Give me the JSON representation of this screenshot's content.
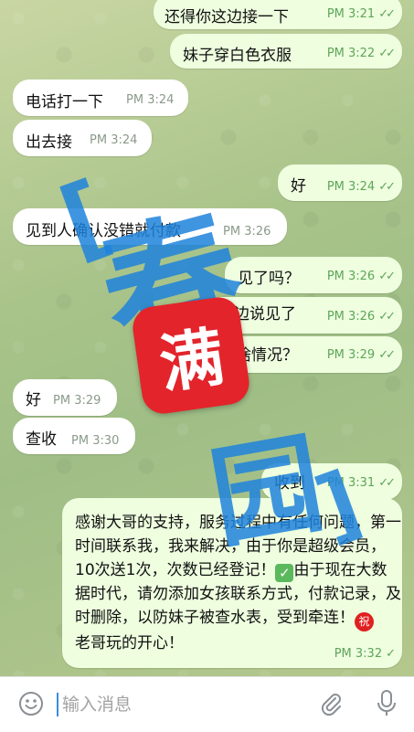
{
  "messages": [
    {
      "id": "m1",
      "dir": "out",
      "text": "还得你这边接一下",
      "time": "PM 3:21",
      "ticks": "✓✓"
    },
    {
      "id": "m2",
      "dir": "out",
      "text": "妹子穿白色衣服",
      "time": "PM 3:22",
      "ticks": "✓✓"
    },
    {
      "id": "m3",
      "dir": "in",
      "text": "电话打一下",
      "time": "PM 3:24"
    },
    {
      "id": "m4",
      "dir": "in",
      "text": "出去接",
      "time": "PM 3:24"
    },
    {
      "id": "m5",
      "dir": "out",
      "text": "好",
      "time": "PM 3:24",
      "ticks": "✓✓"
    },
    {
      "id": "m6",
      "dir": "in",
      "text": "见到人确认没错就付款",
      "time": "PM 3:26"
    },
    {
      "id": "m7",
      "dir": "out",
      "text": "见了吗？",
      "time": "PM 3:26",
      "ticks": "✓✓"
    },
    {
      "id": "m8",
      "dir": "out",
      "text": "这边说见了",
      "time": "PM 3:26",
      "ticks": "✓✓"
    },
    {
      "id": "m9",
      "dir": "out",
      "text": "啥情况？",
      "time": "PM 3:29",
      "ticks": "✓✓"
    },
    {
      "id": "m10",
      "dir": "in",
      "text": "好",
      "time": "PM 3:29"
    },
    {
      "id": "m11",
      "dir": "in",
      "text": "查收",
      "time": "PM 3:30"
    },
    {
      "id": "m12",
      "dir": "out",
      "text": "收到",
      "time": "PM 3:31",
      "ticks": "✓✓"
    },
    {
      "id": "m13",
      "dir": "out",
      "text_before_check": "感谢大哥的支持，服务过程中有任何问题，第一时间联系我，我来解决，由于你是超级会员，10次送1次，次数已经登记！",
      "check_emoji": "✅",
      "text_after_check": "由于现在大数据时代，请勿添加女孩联系方式，付款记录，及时删除，以防妹子被查水表，受到牵连！",
      "blessing_emoji": "祝",
      "text_end": "老哥玩的开心！",
      "time": "PM 3:32",
      "ticks": "✓"
    }
  ],
  "watermark": {
    "stamp_text": "满",
    "chars": [
      "春",
      "园",
      "[",
      "]"
    ]
  },
  "input": {
    "placeholder": "输入消息",
    "emoji_icon": "smile-icon",
    "attach_icon": "paperclip-icon",
    "mic_icon": "microphone-icon"
  },
  "colors": {
    "outgoing_bubble": "#eefedf",
    "incoming_bubble": "#ffffff",
    "tick_color": "#5ea55a",
    "watermark_blue": "#1e82dc",
    "stamp_red": "#e3242b"
  }
}
